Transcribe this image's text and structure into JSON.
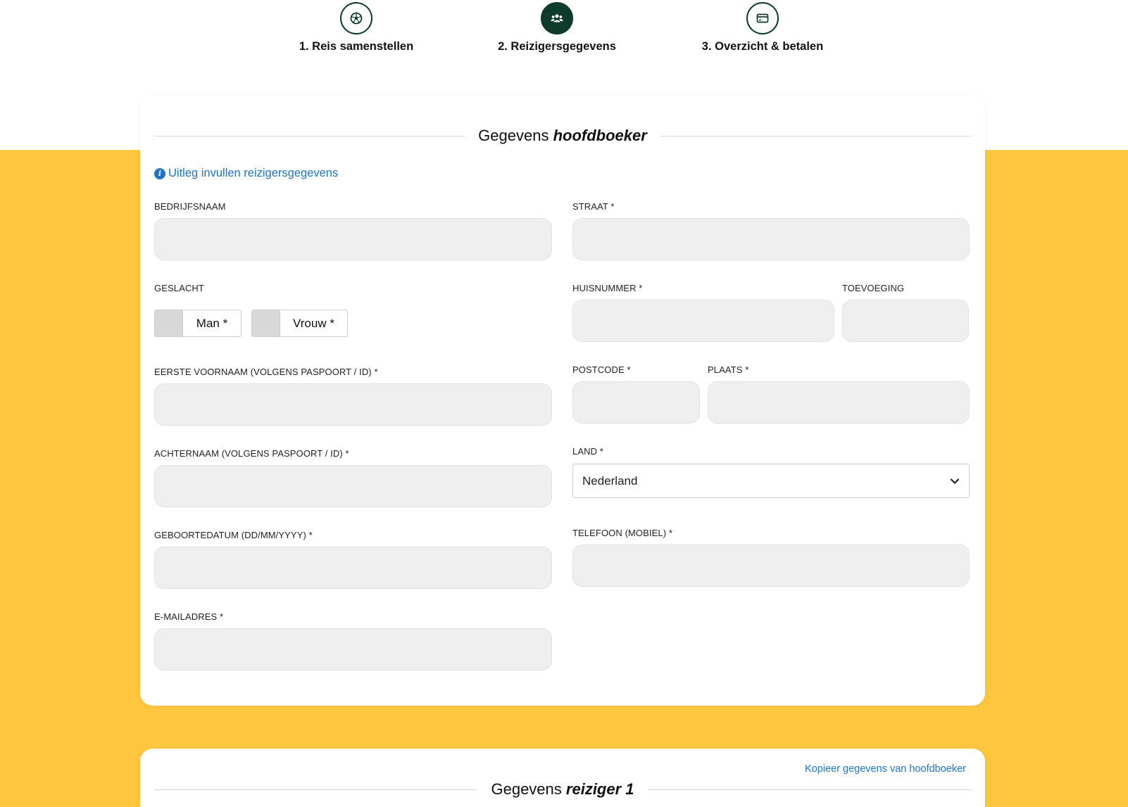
{
  "steps": [
    {
      "label": "1. Reis samenstellen",
      "icon": "soccer-ball-icon",
      "active": false
    },
    {
      "label": "2. Reizigersgegevens",
      "icon": "users-icon",
      "active": true
    },
    {
      "label": "3. Overzicht & betalen",
      "icon": "credit-card-icon",
      "active": false
    }
  ],
  "main_booker": {
    "title_prefix": "Gegevens",
    "title_emphasis": "hoofdboeker",
    "help_link": "Uitleg invullen reizigersgegevens",
    "fields": {
      "company": {
        "label": "BEDRIJFSNAAM",
        "value": ""
      },
      "gender": {
        "label": "GESLACHT",
        "options": [
          "Man *",
          "Vrouw *"
        ]
      },
      "first_name": {
        "label": "EERSTE VOORNAAM (VOLGENS PASPOORT / ID) *",
        "value": ""
      },
      "last_name": {
        "label": "ACHTERNAAM (VOLGENS PASPOORT / ID) *",
        "value": ""
      },
      "birth_date": {
        "label": "GEBOORTEDATUM (DD/MM/YYYY) *",
        "value": ""
      },
      "email": {
        "label": "E-MAILADRES *",
        "value": ""
      },
      "street": {
        "label": "STRAAT *",
        "value": ""
      },
      "house_number": {
        "label": "HUISNUMMER *",
        "value": ""
      },
      "addition": {
        "label": "TOEVOEGING",
        "value": ""
      },
      "postcode": {
        "label": "POSTCODE *",
        "value": ""
      },
      "city": {
        "label": "PLAATS *",
        "value": ""
      },
      "country": {
        "label": "LAND *",
        "value": "Nederland"
      },
      "phone": {
        "label": "TELEFOON (MOBIEL) *",
        "value": ""
      }
    }
  },
  "traveler1": {
    "title_prefix": "Gegevens",
    "title_emphasis": "reiziger 1",
    "copy_link": "Kopieer gegevens van hoofdboeker"
  },
  "colors": {
    "accent_dark_green": "#0f3b2b",
    "link_blue": "#1f74c4",
    "background_yellow": "#fec63f"
  }
}
